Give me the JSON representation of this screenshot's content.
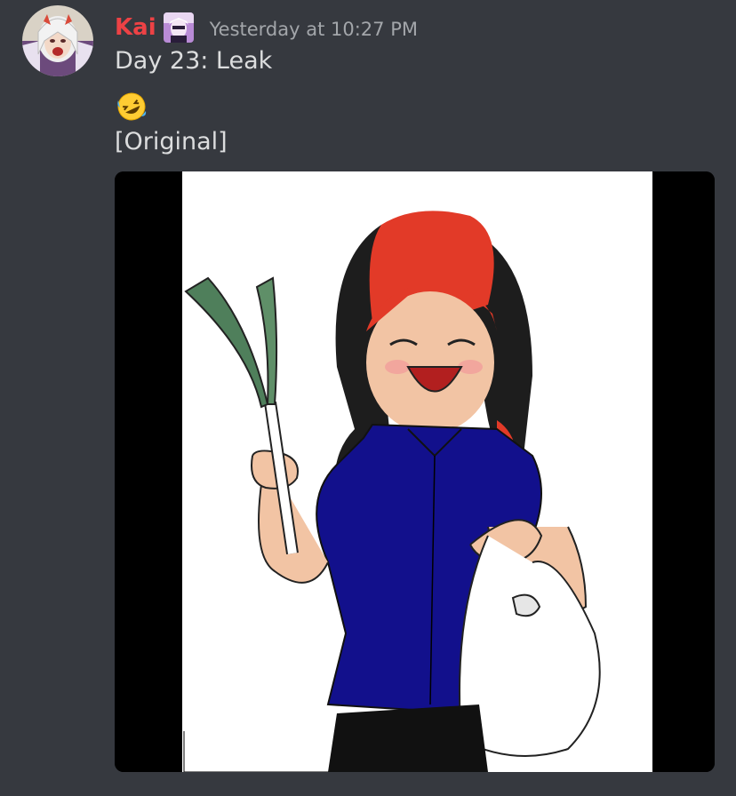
{
  "message": {
    "author": "Kai",
    "timestamp": "Yesterday at 10:27 PM",
    "lines": [
      "Day 23: Leak",
      "[Original]"
    ],
    "emoji": "rolling-on-floor-laughing",
    "attachment": {
      "type": "image",
      "description_icon": "drawing-of-girl-holding-leek-and-bag"
    }
  },
  "colors": {
    "background": "#36393f",
    "username": "#ed4245",
    "timestamp": "#a3a6aa",
    "text": "#dcddde"
  }
}
